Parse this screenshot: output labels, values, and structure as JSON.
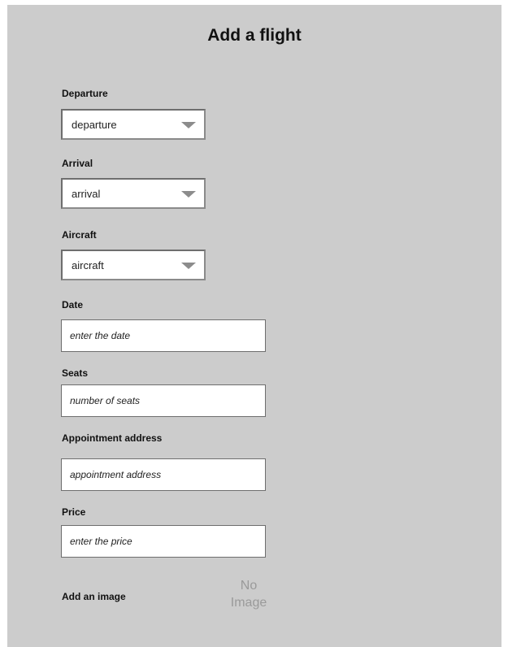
{
  "form": {
    "title": "Add a flight",
    "departure": {
      "label": "Departure",
      "value": "departure"
    },
    "arrival": {
      "label": "Arrival",
      "value": "arrival"
    },
    "aircraft": {
      "label": "Aircraft",
      "value": "aircraft"
    },
    "date": {
      "label": "Date",
      "placeholder": "enter the date"
    },
    "seats": {
      "label": "Seats",
      "placeholder": "number of seats"
    },
    "appointment_address": {
      "label": "Appointment address",
      "placeholder": "appointment address"
    },
    "price": {
      "label": "Price",
      "placeholder": "enter the price"
    },
    "image": {
      "label": "Add an image",
      "placeholder_line1": "No",
      "placeholder_line2": "Image"
    }
  },
  "colors": {
    "panel_background": "#cccccc",
    "field_background": "#ffffff",
    "field_border": "#6e6e6e",
    "dropdown_arrow": "#8c8c8c",
    "placeholder_image_text": "#9a9a9a"
  },
  "icons": {
    "dropdown": "chevron-down-icon"
  }
}
